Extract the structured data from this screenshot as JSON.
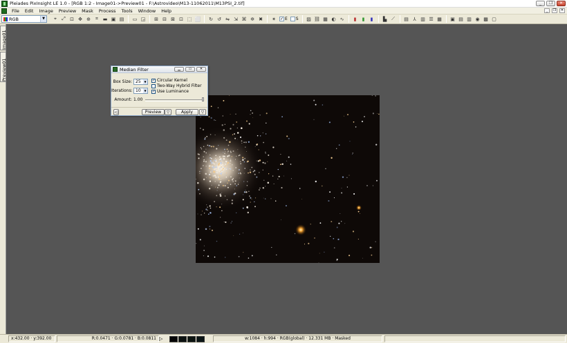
{
  "window": {
    "title": "Pleiades PixInsight LE 1.0 - [RGB 1:2 - Image01->Preview01 - F:\\Astrovideo\\M13-11062011\\M13PSI_2.tif]",
    "minimize": "_",
    "restore": "❐",
    "close": "✕"
  },
  "menu": {
    "items": [
      "File",
      "Edit",
      "Image",
      "Preview",
      "Mask",
      "Process",
      "Tools",
      "Window",
      "Help"
    ],
    "mdi_minimize": "_",
    "mdi_restore": "❐",
    "mdi_close": "✕"
  },
  "toolbar": {
    "channel_select": "RGB",
    "check_e_label": "E",
    "check_s_label": "S"
  },
  "side_tabs": {
    "image_tab": "Image01",
    "preview_tab": "Preview01"
  },
  "dialog": {
    "title": "Median Filter",
    "box_size_label": "Box Size:",
    "box_size_value": "25",
    "iterations_label": "Iterations:",
    "iterations_value": "10",
    "amount_label": "Amount:",
    "amount_value": "1.00",
    "circular_kernel_label": "Circular Kernel",
    "circular_kernel_checked": true,
    "two_way_hybrid_label": "Two-Way Hybrid Filter",
    "two_way_hybrid_checked": false,
    "use_luminance_label": "Use Luminance",
    "use_luminance_checked": true,
    "preview_button": "Preview",
    "apply_button": "Apply",
    "amount_fraction": 1.0
  },
  "statusbar": {
    "cursor_pos": "x:432.00 · y:392.00",
    "pixel_values": "R:0.0471 · G:0.0781 · B:0.0811",
    "image_info": "w:1084 · h:994 · RGB(global) · 12.331 MB · Masked"
  }
}
